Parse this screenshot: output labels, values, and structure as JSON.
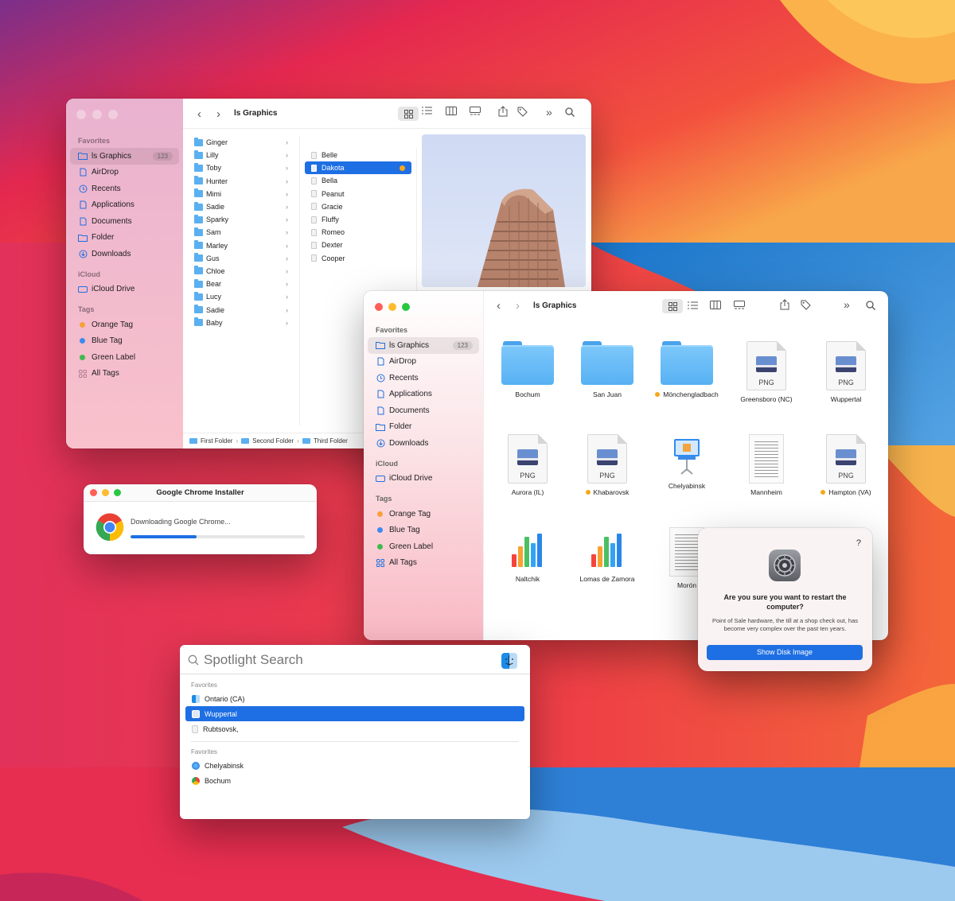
{
  "finder_back": {
    "title": "ls Graphics",
    "sidebar": {
      "sections": [
        {
          "label": "Favorites",
          "items": [
            {
              "label": "ls Graphics",
              "count": "123",
              "icon": "folder-icon"
            },
            {
              "label": "AirDrop",
              "icon": "airdrop-icon"
            },
            {
              "label": "Recents",
              "icon": "clock-icon"
            },
            {
              "label": "Applications",
              "icon": "applications-icon"
            },
            {
              "label": "Documents",
              "icon": "document-icon"
            },
            {
              "label": "Folder",
              "icon": "folder-icon"
            },
            {
              "label": "Downloads",
              "icon": "download-icon"
            }
          ]
        },
        {
          "label": "iCloud",
          "items": [
            {
              "label": "iCloud Drive",
              "icon": "cloud-icon"
            }
          ]
        },
        {
          "label": "Tags",
          "items": [
            {
              "label": "Orange Tag",
              "color": "#f6a13a"
            },
            {
              "label": "Blue Tag",
              "color": "#3c8af2"
            },
            {
              "label": "Green Label",
              "color": "#3fba4f"
            },
            {
              "label": "All Tags",
              "icon": "tags-icon"
            }
          ]
        }
      ]
    },
    "column1": [
      "Ginger",
      "Lilly",
      "Toby",
      "Hunter",
      "Mimi",
      "Sadie",
      "Sparky",
      "Sam",
      "Marley",
      "Gus",
      "Chloe",
      "Bear",
      "Lucy",
      "Sadie",
      "Baby"
    ],
    "column2": [
      "Belle",
      "Dakota",
      "Bella",
      "Peanut",
      "Gracie",
      "Fluffy",
      "Romeo",
      "Dexter",
      "Cooper"
    ],
    "selected_in_column2": "Dakota",
    "path": [
      "First Folder",
      "Second Folder",
      "Third Folder"
    ]
  },
  "finder_front": {
    "title": "ls Graphics",
    "sidebar": {
      "sections": [
        {
          "label": "Favorites",
          "items": [
            {
              "label": "ls Graphics",
              "count": "123"
            },
            {
              "label": "AirDrop"
            },
            {
              "label": "Recents"
            },
            {
              "label": "Applications"
            },
            {
              "label": "Documents"
            },
            {
              "label": "Folder"
            },
            {
              "label": "Downloads"
            }
          ]
        },
        {
          "label": "iCloud",
          "items": [
            {
              "label": "iCloud Drive"
            }
          ]
        },
        {
          "label": "Tags",
          "items": [
            {
              "label": "Orange Tag"
            },
            {
              "label": "Blue Tag"
            },
            {
              "label": "Green Label"
            },
            {
              "label": "All Tags"
            }
          ]
        }
      ]
    },
    "files": [
      {
        "name": "Bochum",
        "kind": "folder"
      },
      {
        "name": "San Juan",
        "kind": "folder"
      },
      {
        "name": "Mönchengladbach",
        "kind": "folder",
        "tag": "#f6a81a"
      },
      {
        "name": "Greensboro (NC)",
        "kind": "png"
      },
      {
        "name": "Wuppertal",
        "kind": "png"
      },
      {
        "name": "Aurora (IL)",
        "kind": "png"
      },
      {
        "name": "Khabarovsk",
        "kind": "png",
        "tag": "#f6a81a"
      },
      {
        "name": "Chelyabinsk",
        "kind": "keynote"
      },
      {
        "name": "Mannheim",
        "kind": "text"
      },
      {
        "name": "Hampton (VA)",
        "kind": "png",
        "tag": "#f6a81a"
      },
      {
        "name": "Naltchik",
        "kind": "numbers"
      },
      {
        "name": "Lomas de Zamora",
        "kind": "numbers"
      },
      {
        "name": "Morón",
        "kind": "text"
      }
    ],
    "png_label": "PNG"
  },
  "installer": {
    "title": "Google Chrome Installer",
    "status": "Downloading Google Chrome...",
    "progress": 0.38
  },
  "restart_dialog": {
    "help": "?",
    "heading": "Are you sure you want to restart the computer?",
    "body": "Point of Sale hardware, the till at a shop check out, has become very complex over the past ten years.",
    "button": "Show Disk Image"
  },
  "spotlight": {
    "placeholder": "Spotlight Search",
    "group1_label": "Favorites",
    "group1": [
      "Ontario (CA)",
      "Wuppertal",
      "Rubtsovsk,"
    ],
    "selected": "Wuppertal",
    "group2_label": "Favorites",
    "group2": [
      "Chelyabinsk",
      "Bochum"
    ]
  },
  "colors": {
    "accent": "#1e6fe3",
    "tag_orange": "#f6a81a",
    "tag_blue": "#3c8af2",
    "tag_green": "#3fba4f"
  }
}
